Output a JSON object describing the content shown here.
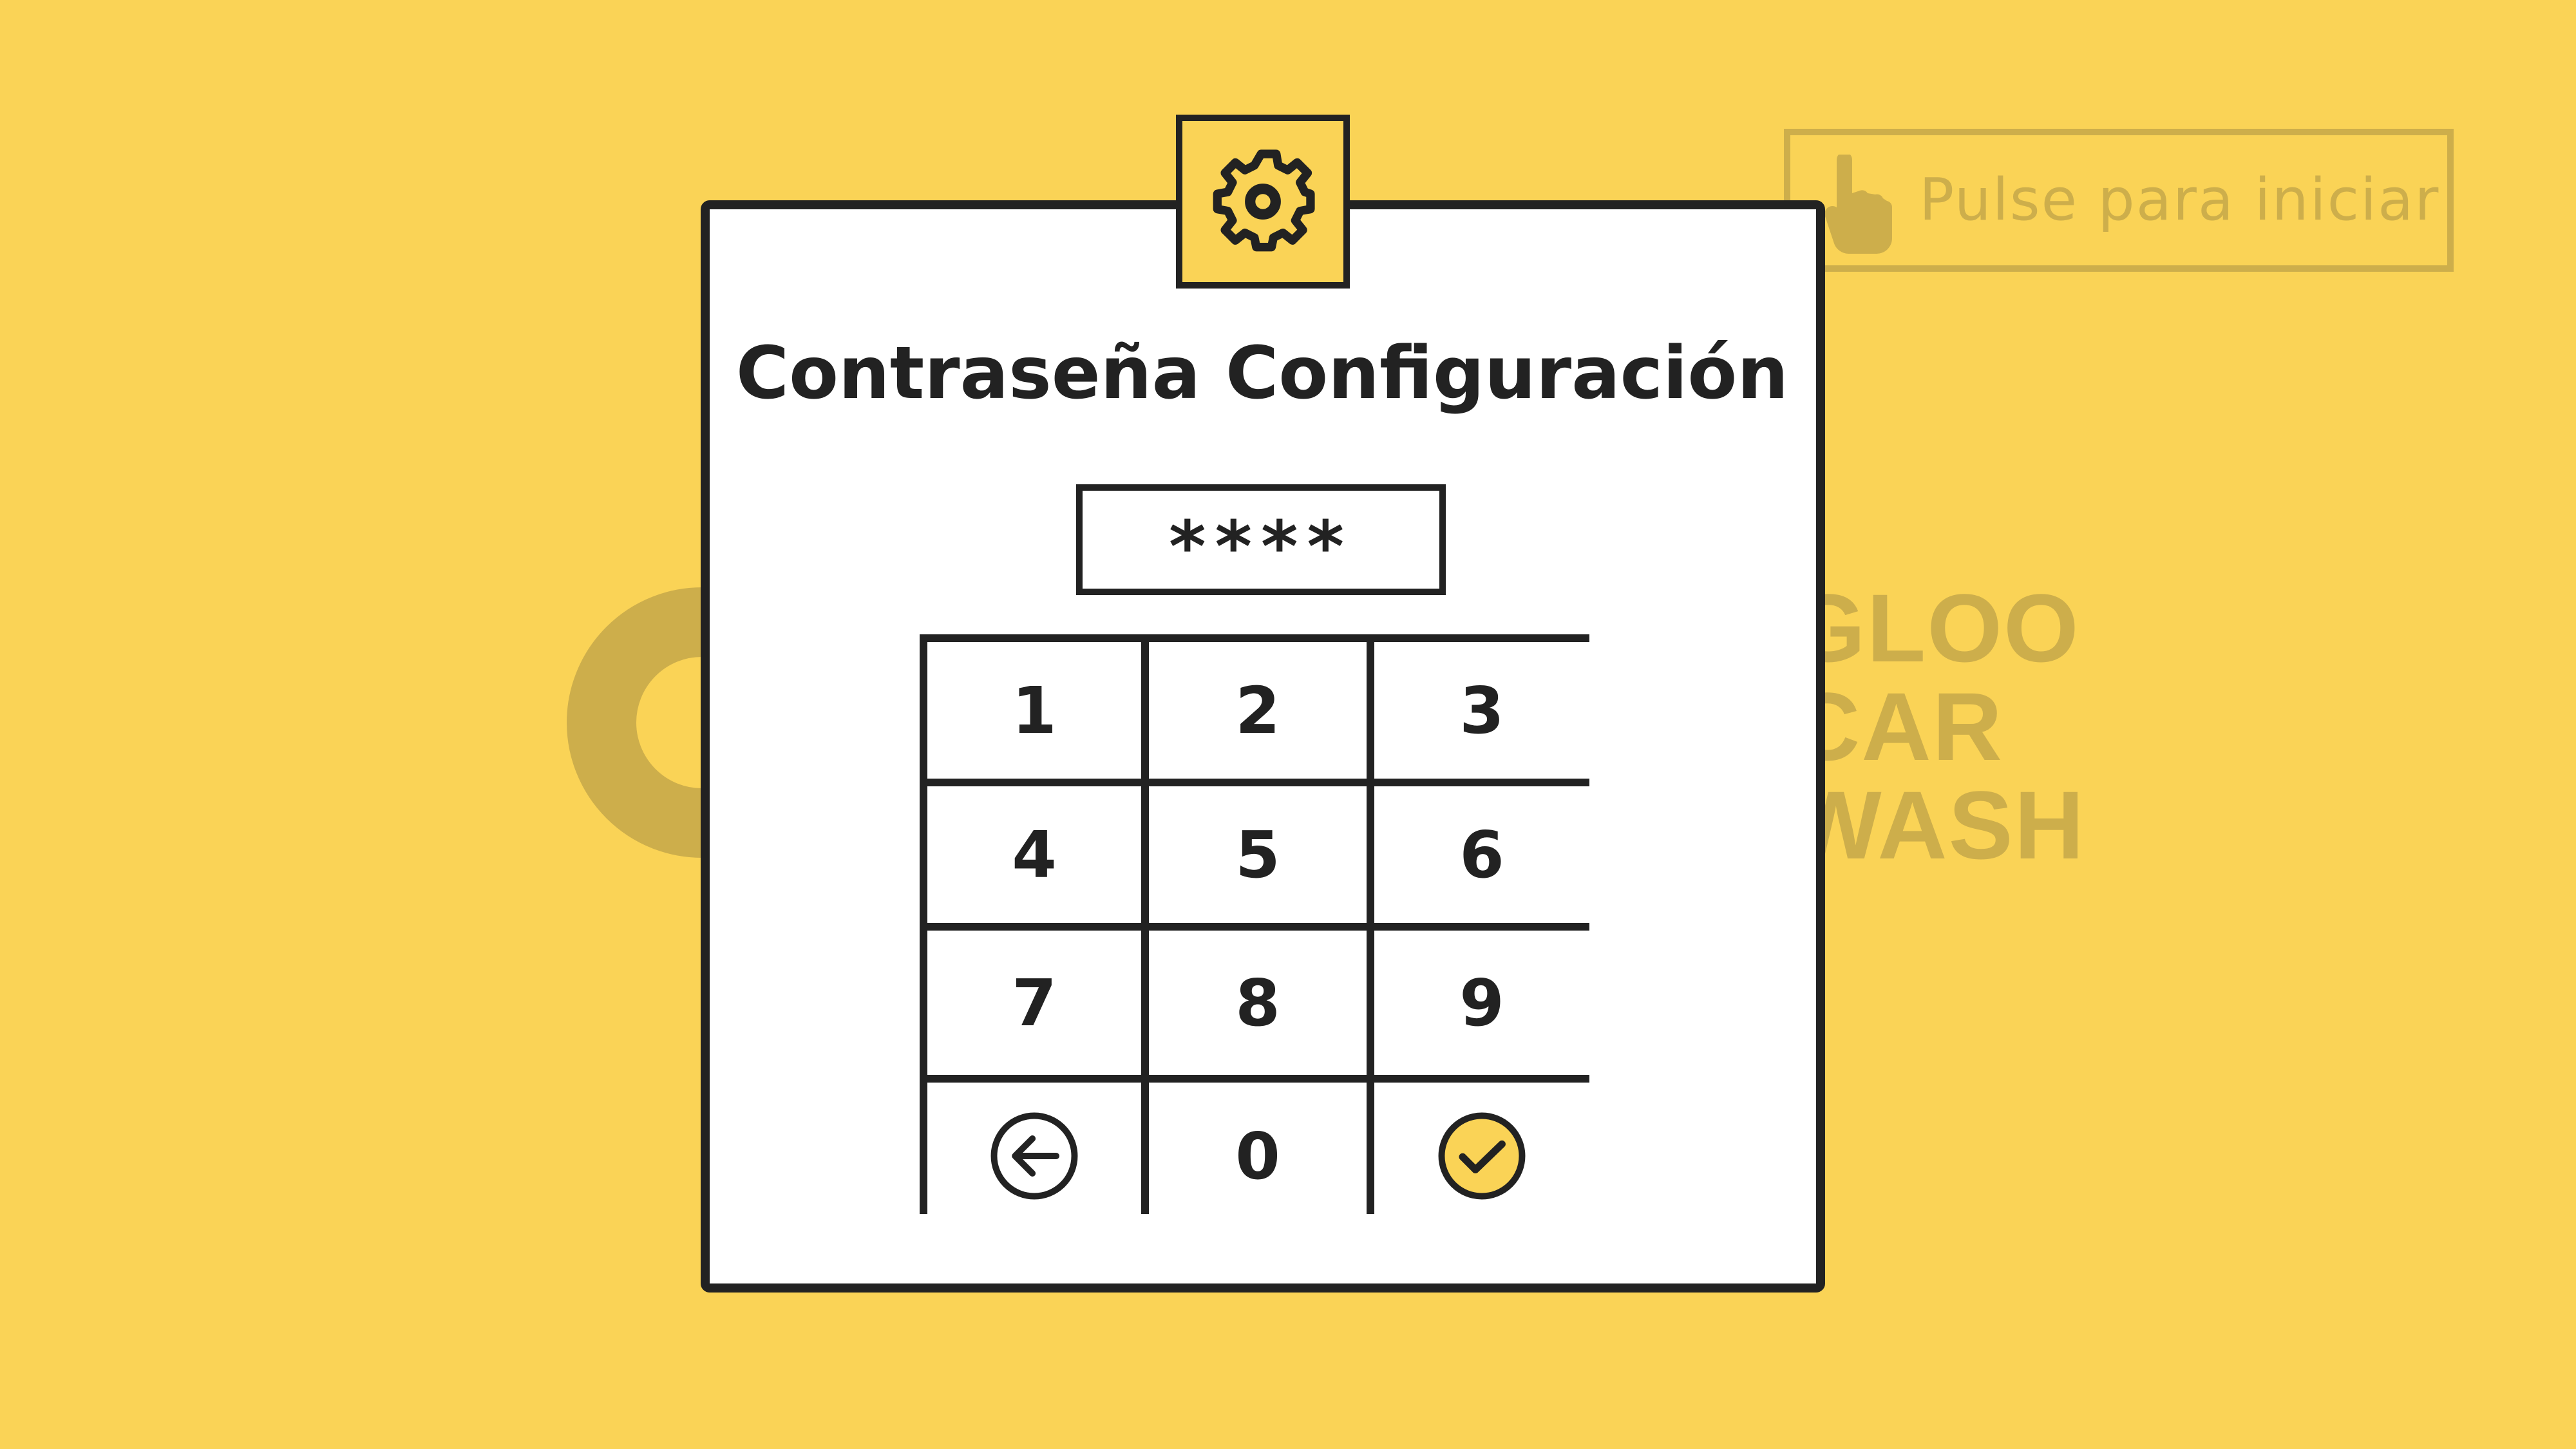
{
  "colors": {
    "background": "#FAD356",
    "watermark": "#CDAE4B",
    "accent": "#FAD356",
    "ink": "#222222",
    "panel": "#FFFFFF"
  },
  "start_button": {
    "label": "Pulse para iniciar",
    "icon": "tap-hand-icon"
  },
  "brand": {
    "lines": [
      "GLOO",
      "CAR",
      "WASH"
    ]
  },
  "dialog": {
    "icon": "gear-icon",
    "title": "Contraseña Configuración",
    "pin_masked": "****"
  },
  "keypad": {
    "keys": [
      "1",
      "2",
      "3",
      "4",
      "5",
      "6",
      "7",
      "8",
      "9"
    ],
    "zero": "0",
    "back_icon": "arrow-left-circle-icon",
    "confirm_icon": "check-circle-icon"
  }
}
